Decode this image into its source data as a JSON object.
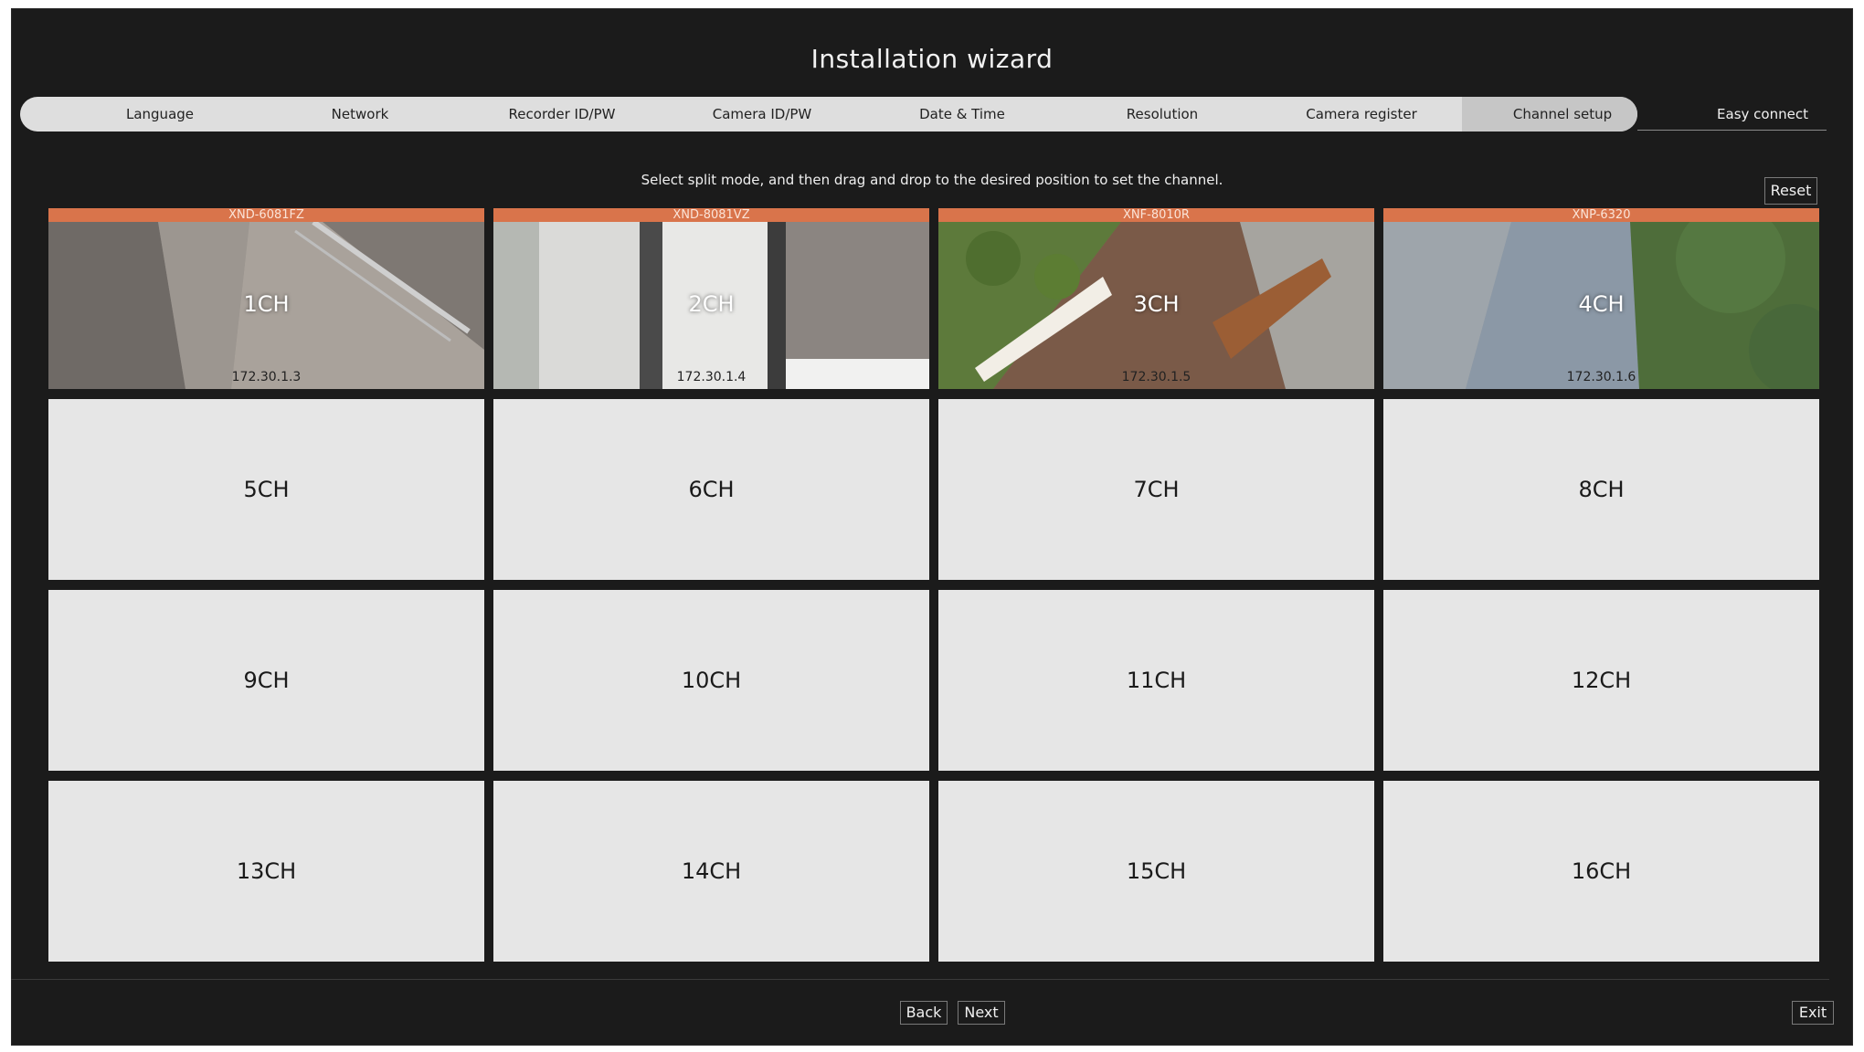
{
  "window": {
    "title": "Installation wizard"
  },
  "steps": [
    {
      "label": "Language"
    },
    {
      "label": "Network"
    },
    {
      "label": "Recorder ID/PW"
    },
    {
      "label": "Camera ID/PW"
    },
    {
      "label": "Date & Time"
    },
    {
      "label": "Resolution"
    },
    {
      "label": "Camera register"
    },
    {
      "label": "Channel setup"
    },
    {
      "label": "Easy connect"
    }
  ],
  "active_step": "Channel setup",
  "instruction": "Select split mode, and then drag and drop to the desired position to set the channel.",
  "reset_label": "Reset",
  "channels": [
    {
      "label": "1CH",
      "model": "XND-6081FZ",
      "ip": "172.30.1.3"
    },
    {
      "label": "2CH",
      "model": "XND-8081VZ",
      "ip": "172.30.1.4"
    },
    {
      "label": "3CH",
      "model": "XNF-8010R",
      "ip": "172.30.1.5"
    },
    {
      "label": "4CH",
      "model": "XNP-6320",
      "ip": "172.30.1.6"
    },
    {
      "label": "5CH"
    },
    {
      "label": "6CH"
    },
    {
      "label": "7CH"
    },
    {
      "label": "8CH"
    },
    {
      "label": "9CH"
    },
    {
      "label": "10CH"
    },
    {
      "label": "11CH"
    },
    {
      "label": "12CH"
    },
    {
      "label": "13CH"
    },
    {
      "label": "14CH"
    },
    {
      "label": "15CH"
    },
    {
      "label": "16CH"
    }
  ],
  "footer": {
    "back_label": "Back",
    "next_label": "Next",
    "exit_label": "Exit"
  },
  "colors": {
    "camera_header": "#d9744b",
    "background": "#1b1b1b",
    "tile": "#e6e6e6"
  }
}
